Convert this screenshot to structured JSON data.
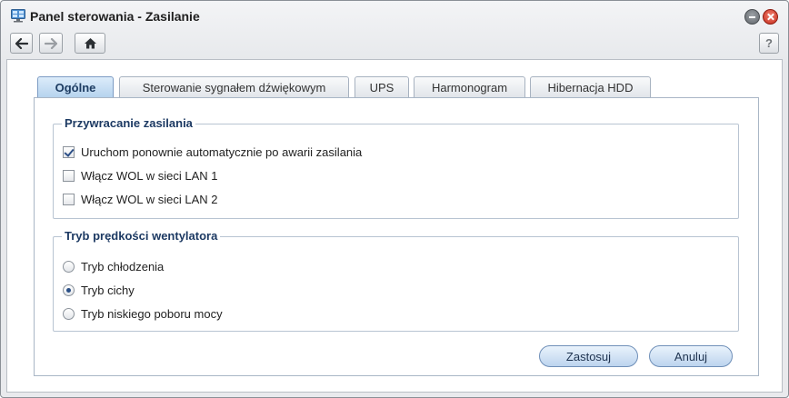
{
  "window": {
    "title": "Panel sterowania - Zasilanie",
    "icons": {
      "app": "control-panel-icon",
      "minimize": "minimize-icon",
      "close": "close-icon"
    }
  },
  "toolbar": {
    "back_icon": "arrow-left-icon",
    "forward_icon": "arrow-right-icon",
    "home_icon": "home-icon",
    "help_label": "?"
  },
  "tabs": [
    {
      "label": "Ogólne",
      "active": true
    },
    {
      "label": "Sterowanie sygnałem dźwiękowym",
      "active": false
    },
    {
      "label": "UPS",
      "active": false
    },
    {
      "label": "Harmonogram",
      "active": false
    },
    {
      "label": "Hibernacja HDD",
      "active": false
    }
  ],
  "power_recovery": {
    "legend": "Przywracanie zasilania",
    "options": [
      {
        "label": "Uruchom ponownie automatycznie po awarii zasilania",
        "checked": true
      },
      {
        "label": "Włącz WOL w sieci LAN 1",
        "checked": false
      },
      {
        "label": "Włącz WOL w sieci LAN 2",
        "checked": false
      }
    ]
  },
  "fan_mode": {
    "legend": "Tryb prędkości wentylatora",
    "options": [
      {
        "label": "Tryb chłodzenia",
        "selected": false
      },
      {
        "label": "Tryb cichy",
        "selected": true
      },
      {
        "label": "Tryb niskiego poboru mocy",
        "selected": false
      }
    ]
  },
  "actions": {
    "apply_label": "Zastosuj",
    "cancel_label": "Anuluj"
  },
  "colors": {
    "accent": "#1d3a63",
    "active_tab": "#b6d3ee",
    "button": "#bcd4ee",
    "close": "#c62a1a"
  }
}
